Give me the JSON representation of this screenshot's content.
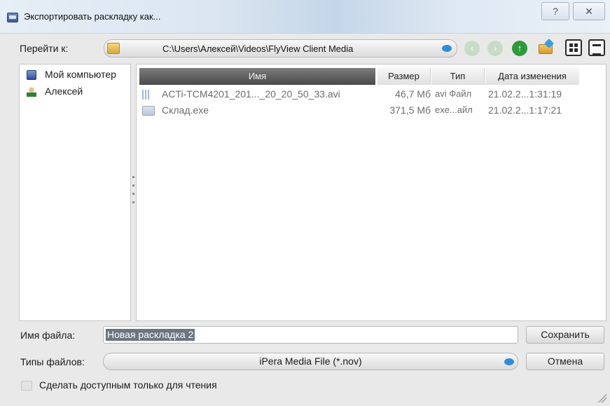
{
  "window": {
    "title": "Экспортировать раскладку как...",
    "help_glyph": "?",
    "close_glyph": "✕"
  },
  "nav": {
    "label": "Перейти к:",
    "path": "C:\\Users\\Алексей\\Videos\\FlyView Client Media",
    "icons": [
      "back-icon",
      "forward-icon",
      "up-icon",
      "new-folder-icon",
      "detail-view-icon",
      "list-view-icon"
    ]
  },
  "sidebar": {
    "items": [
      {
        "label": "Мой компьютер",
        "icon": "computer-icon"
      },
      {
        "label": "Алексей",
        "icon": "user-icon"
      }
    ]
  },
  "filelist": {
    "columns": [
      "Имя",
      "Размер",
      "Тип",
      "Дата изменения"
    ],
    "rows": [
      {
        "name": "ACTi-TCM4201_201..._20_20_50_33.avi",
        "size": "46,7 Мб",
        "type": "avi Файл",
        "date": "21.02.2...1:31:19",
        "icon": "video-file-icon"
      },
      {
        "name": "Склад.exe",
        "size": "371,5 Мб",
        "type": "exe...айл",
        "date": "21.02.2...1:17:21",
        "icon": "exe-file-icon"
      }
    ]
  },
  "form": {
    "filename_label": "Имя файла:",
    "filename_value": "Новая раскладка 2",
    "types_label": "Типы файлов:",
    "types_value": "iPera Media File (*.nov)",
    "save_label": "Сохранить",
    "cancel_label": "Отмена",
    "readonly_label": "Сделать доступным только для чтения"
  },
  "colors": {
    "accent": "#2f8fd6",
    "up_arrow": "#2c9c3a",
    "selection": "#6b7481"
  }
}
